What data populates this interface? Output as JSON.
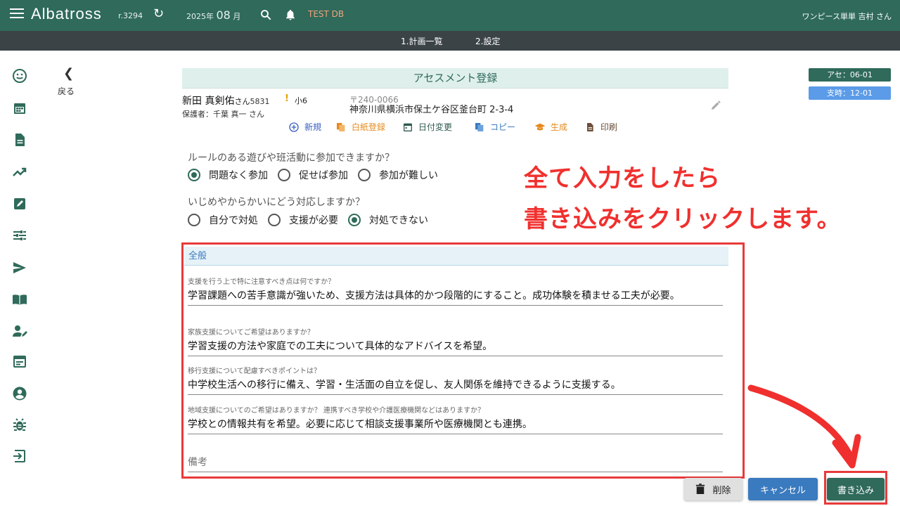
{
  "header": {
    "app_name": "Albatross",
    "revision": "r.3294",
    "date_year_prefix": "2025年",
    "date_month": "08",
    "date_month_suffix": "月",
    "db_label": "TEST DB",
    "user": "ワンピース単単 吉村 さん"
  },
  "subnav": [
    "1.計画一覧",
    "2.設定"
  ],
  "back_label": "戻る",
  "tags": {
    "assessment": "アセ：06-01",
    "support": "支時：12-01"
  },
  "panel_title": "アセスメント登録",
  "person": {
    "name": "新田 真剣佑",
    "honorific": "さん",
    "id": "5831",
    "warning": "!",
    "grade": "小6",
    "guardian": "保護者：千葉 真一 さん",
    "zip": "〒240-0066",
    "address": "神奈川県横浜市保土ケ谷区釜台町 2-3-4"
  },
  "actions": [
    {
      "label": "新規",
      "color": "#3a5fbf",
      "icon": "plus-circle-icon"
    },
    {
      "label": "白紙登録",
      "color": "#e68a1e",
      "icon": "copy-file-icon"
    },
    {
      "label": "日付変更",
      "color": "#2f5a50",
      "icon": "calendar-icon"
    },
    {
      "label": "コピー",
      "color": "#3a7abf",
      "icon": "copy-icon"
    },
    {
      "label": "生成",
      "color": "#e68a1e",
      "icon": "graduation-cap-icon"
    },
    {
      "label": "印刷",
      "color": "#6b4e3a",
      "icon": "document-icon"
    }
  ],
  "questions": [
    {
      "text": "ルールのある遊びや班活動に参加できますか？",
      "options": [
        "問題なく参加",
        "促せば参加",
        "参加が難しい"
      ],
      "selected": 0
    },
    {
      "text": "いじめやからかいにどう対応しますか？",
      "options": [
        "自分で対処",
        "支援が必要",
        "対処できない"
      ],
      "selected": 2
    }
  ],
  "callout": [
    "全て入力をしたら",
    "書き込みをクリックします。"
  ],
  "section": {
    "title": "全般",
    "fields": [
      {
        "label": "支援を行う上で特に注意すべき点は何ですか？",
        "value": "学習課題への苦手意識が強いため、支援方法は具体的かつ段階的にすること。成功体験を積ませる工夫が必要。"
      },
      {
        "label": "家族支援についてご希望はありますか？",
        "value": "学習支援の方法や家庭での工夫について具体的なアドバイスを希望。"
      },
      {
        "label": "移行支援について配慮すべきポイントは？",
        "value": "中学校生活への移行に備え、学習・生活面の自立を促し、友人関係を維持できるように支援する。"
      },
      {
        "label": "地域支援についてのご希望はありますか？ 連携すべき学校や介護医療機関などはありますか？",
        "value": "学校との情報共有を希望。必要に応じて相談支援事業所や医療機関とも連携。"
      }
    ],
    "remark_placeholder": "備考"
  },
  "buttons": {
    "delete": "削除",
    "cancel": "キャンセル",
    "write": "書き込み"
  }
}
